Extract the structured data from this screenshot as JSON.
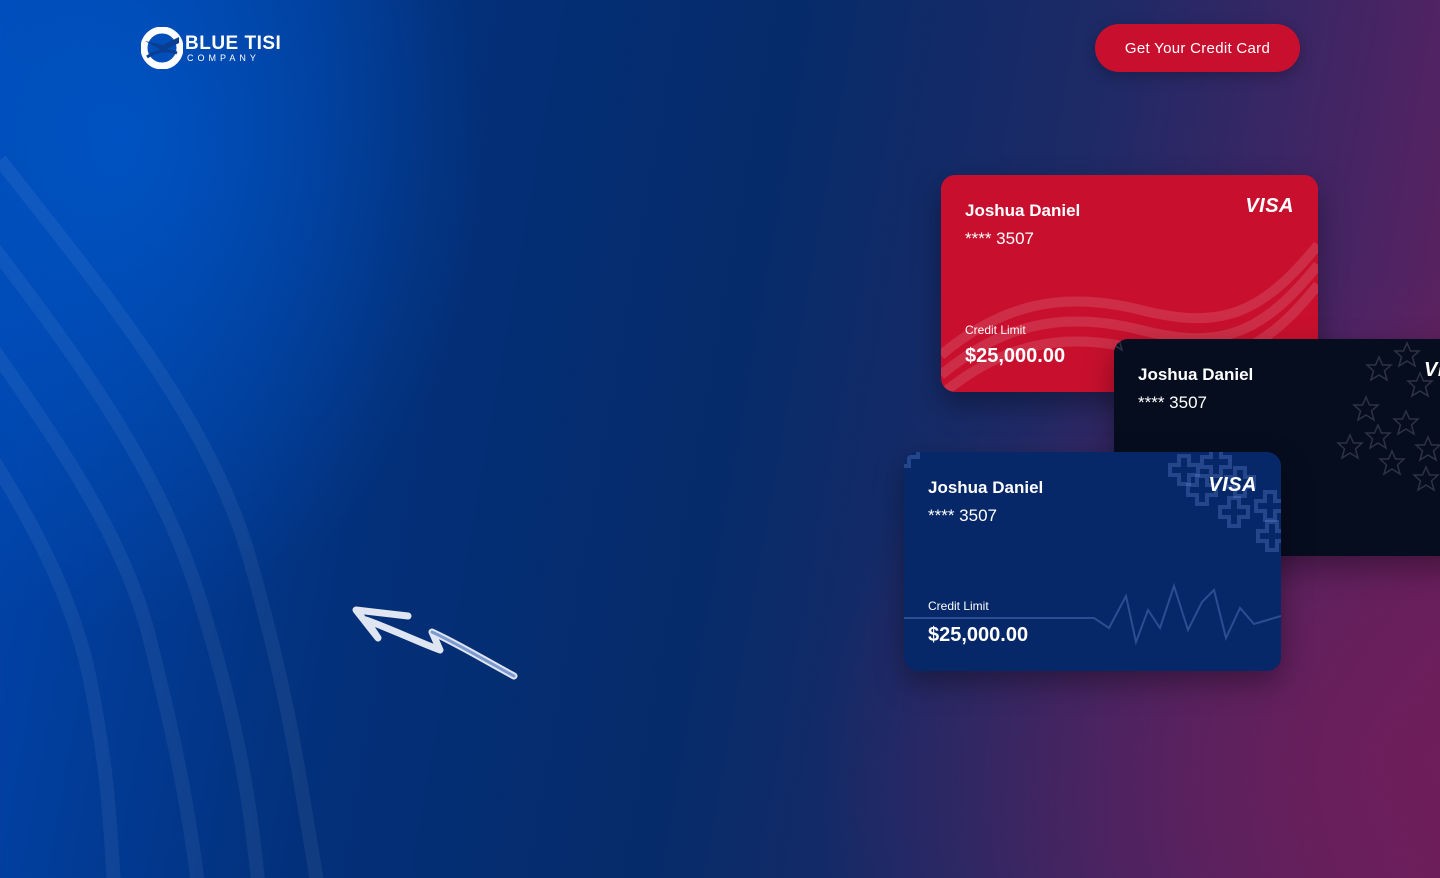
{
  "brand": {
    "name": "BLUE TISI",
    "subtitle": "COMPANY",
    "logo_icon": "swirl-logo-icon"
  },
  "header": {
    "cta_label": "Get Your Credit Card"
  },
  "colors": {
    "cta": "#c8102e",
    "card_red": "#c8102e",
    "card_black": "#060d1f",
    "card_blue": "#062768",
    "background_left": "#0047b3",
    "background_right": "#6a1f5a"
  },
  "cards": [
    {
      "color": "red",
      "holder": "Joshua Daniel",
      "number": "**** 3507",
      "brand": "VISA",
      "limit_label": "Credit Limit",
      "limit_value": "$25,000.00",
      "pattern": "wave-pattern"
    },
    {
      "color": "black",
      "holder": "Joshua Daniel",
      "number": "**** 3507",
      "brand": "VI",
      "pattern": "star-pattern"
    },
    {
      "color": "blue",
      "holder": "Joshua Daniel",
      "number": "**** 3507",
      "brand": "VISA",
      "limit_label": "Credit Limit",
      "limit_value": "$25,000.00",
      "pattern": "heartbeat-cross-pattern"
    }
  ],
  "decorations": {
    "arrow_icon": "hand-drawn-arrow-icon"
  }
}
